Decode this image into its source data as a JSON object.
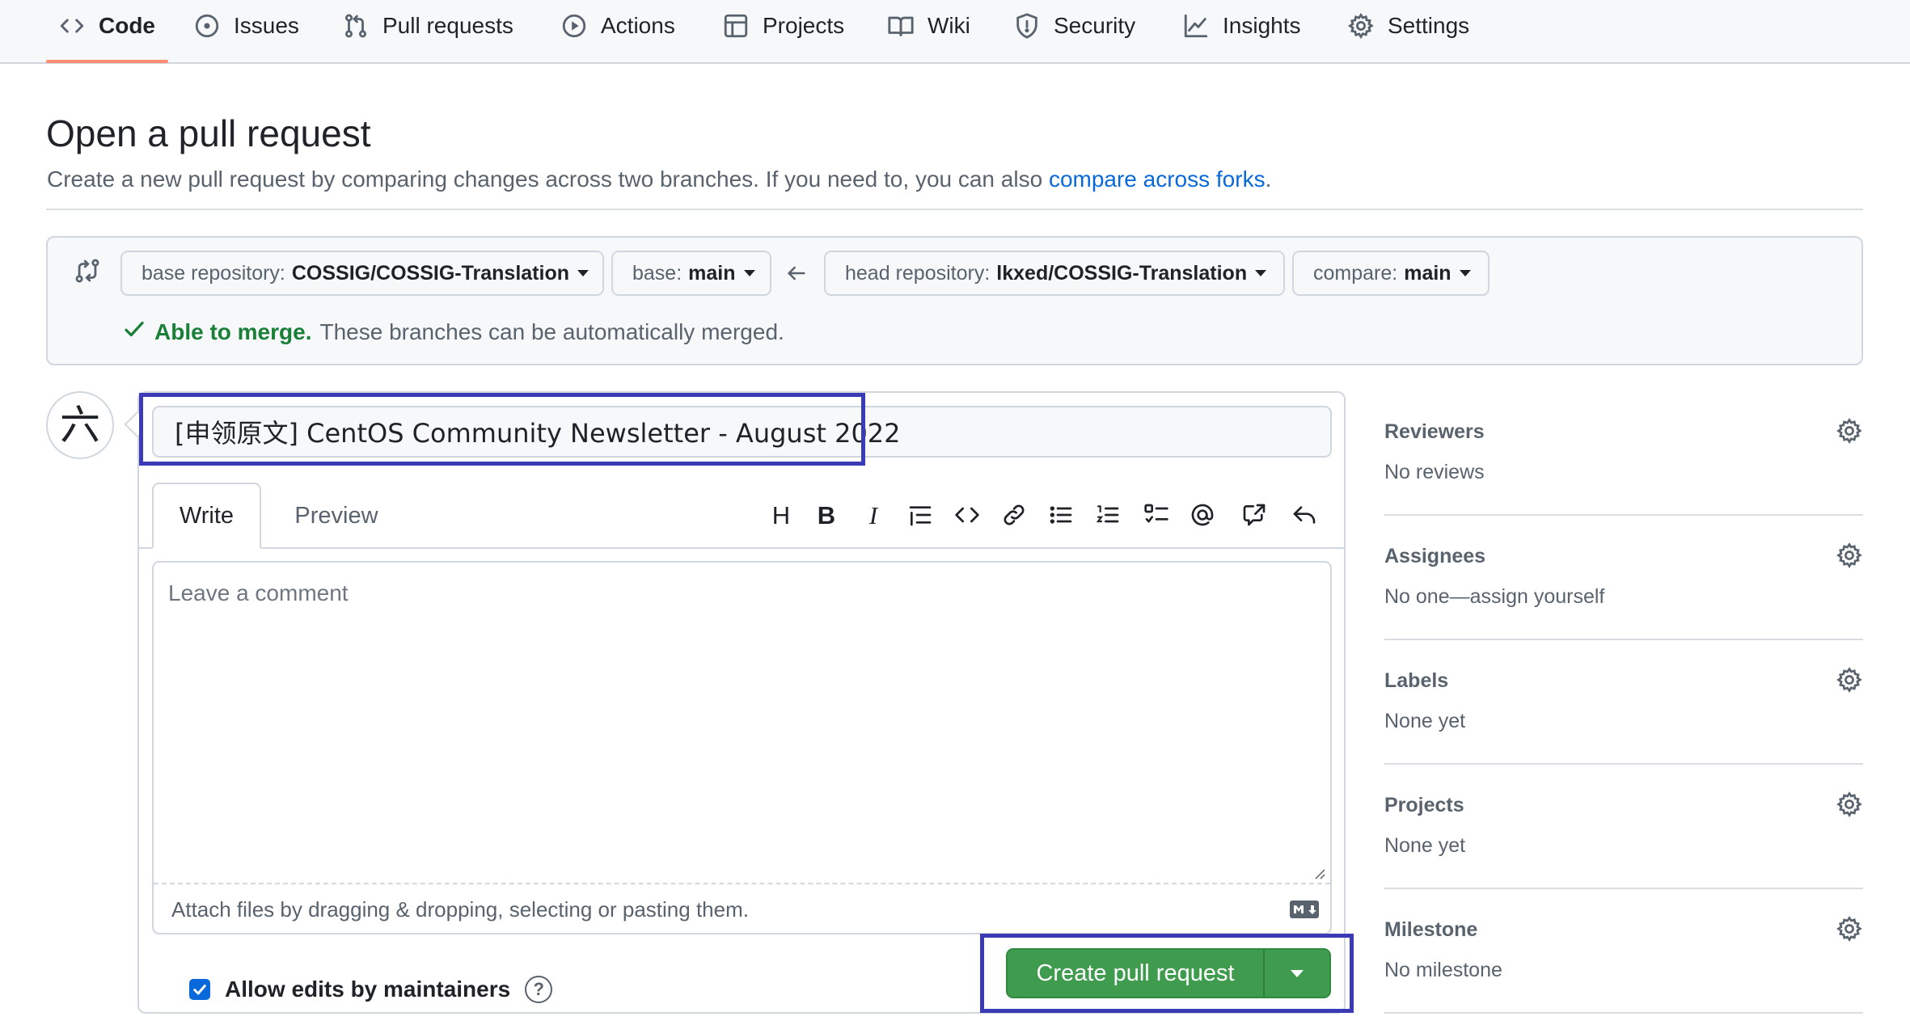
{
  "nav": {
    "tabs": [
      {
        "label": "Code",
        "icon": "code-icon"
      },
      {
        "label": "Issues",
        "icon": "issue-opened-icon"
      },
      {
        "label": "Pull requests",
        "icon": "git-pull-request-icon"
      },
      {
        "label": "Actions",
        "icon": "play-icon"
      },
      {
        "label": "Projects",
        "icon": "table-icon"
      },
      {
        "label": "Wiki",
        "icon": "book-icon"
      },
      {
        "label": "Security",
        "icon": "shield-icon"
      },
      {
        "label": "Insights",
        "icon": "graph-icon"
      },
      {
        "label": "Settings",
        "icon": "gear-icon"
      }
    ],
    "active_tab": "Code"
  },
  "header": {
    "title": "Open a pull request",
    "subtitle_prefix": "Create a new pull request by comparing changes across two branches. If you need to, you can also ",
    "subtitle_link": "compare across forks",
    "subtitle_suffix": "."
  },
  "compare": {
    "base_repo_label": "base repository:",
    "base_repo_value": "COSSIG/COSSIG-Translation",
    "base_label": "base:",
    "base_value": "main",
    "head_repo_label": "head repository:",
    "head_repo_value": "lkxed/COSSIG-Translation",
    "compare_label": "compare:",
    "compare_value": "main",
    "merge_ok": "Able to merge.",
    "merge_text": "These branches can be automatically merged."
  },
  "avatar": {
    "glyph": "六"
  },
  "form": {
    "title_value": "[申领原文] CentOS Community Newsletter - August 2022",
    "tab_write": "Write",
    "tab_preview": "Preview",
    "comment_placeholder": "Leave a comment",
    "attach_text": "Attach files by dragging & dropping, selecting or pasting them.",
    "allow_edits_label": "Allow edits by maintainers",
    "help_glyph": "?",
    "create_button_label": "Create pull request",
    "toolbar": [
      "heading-icon",
      "bold-icon",
      "italic-icon",
      "quote-icon",
      "code-icon",
      "link-icon",
      "unordered-list-icon",
      "ordered-list-icon",
      "tasklist-icon",
      "mention-icon",
      "cross-reference-icon",
      "reply-icon"
    ]
  },
  "sidebar": {
    "sections": [
      {
        "title": "Reviewers",
        "value": "No reviews"
      },
      {
        "title": "Assignees",
        "value": "No one—assign yourself"
      },
      {
        "title": "Labels",
        "value": "None yet"
      },
      {
        "title": "Projects",
        "value": "None yet"
      },
      {
        "title": "Milestone",
        "value": "No milestone"
      }
    ]
  },
  "colors": {
    "accent_link": "#0969da",
    "success": "#1a7f37",
    "create_button": "#3f9c4f",
    "highlight_box": "#3b3bb8",
    "nav_underline": "#fd8c73"
  }
}
